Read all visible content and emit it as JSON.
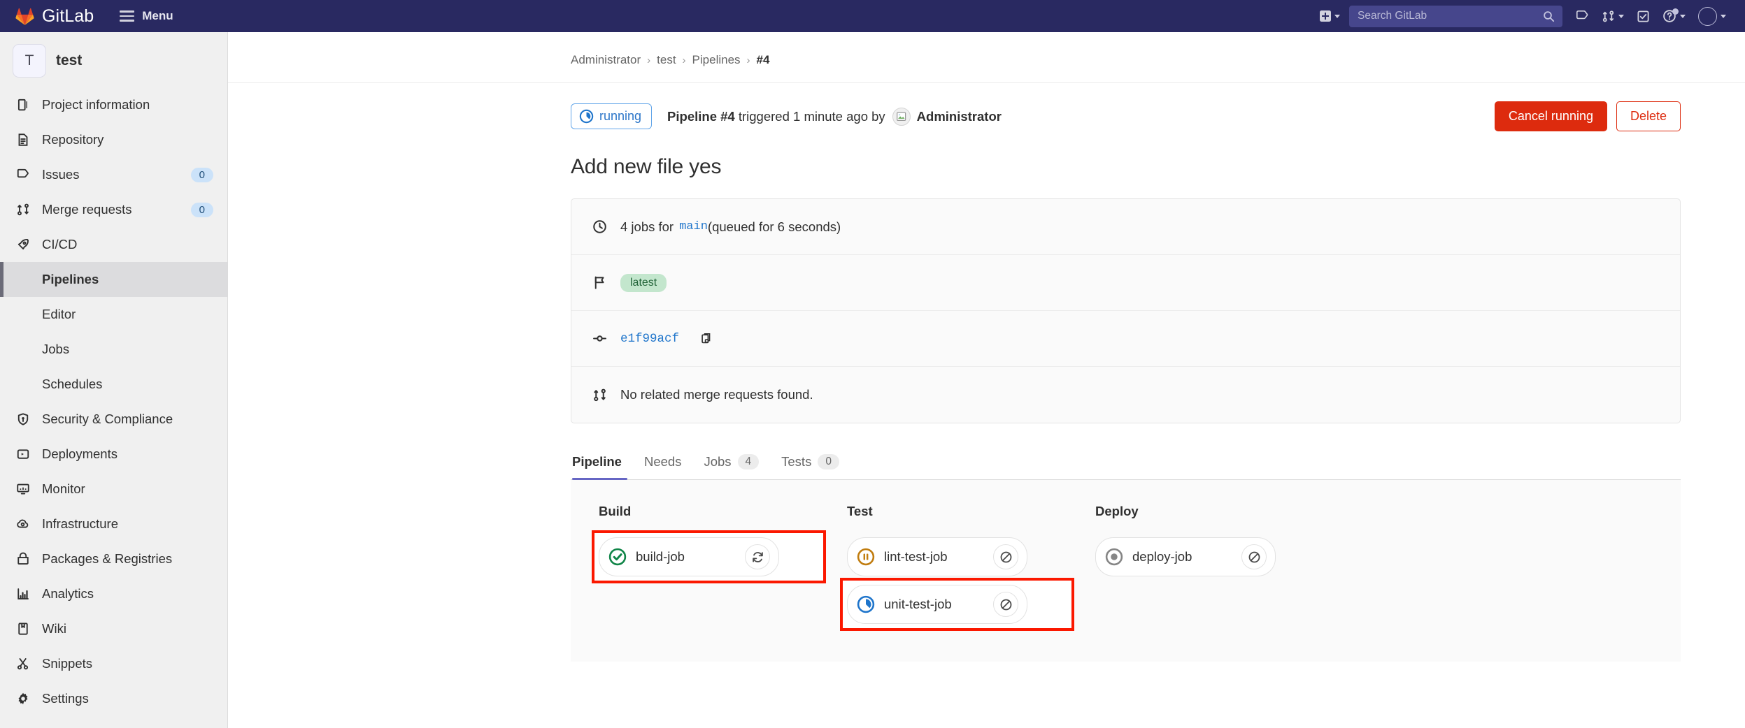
{
  "navbar": {
    "brand": "GitLab",
    "menu_label": "Menu",
    "create_new_label": "Create new",
    "search": {
      "placeholder": "Search GitLab",
      "value": ""
    },
    "icons": [
      {
        "name": "issues-icon",
        "label": "Issues"
      },
      {
        "name": "merge-requests-icon",
        "label": "Merge requests"
      },
      {
        "name": "todos-icon",
        "label": "To-Do List"
      },
      {
        "name": "help-icon",
        "label": "Help"
      },
      {
        "name": "user-avatar",
        "label": "User menu"
      }
    ]
  },
  "sidebar": {
    "project": {
      "initial": "T",
      "name": "test"
    },
    "items": [
      {
        "label": "Project information",
        "icon": "project-information-icon",
        "badge": ""
      },
      {
        "label": "Repository",
        "icon": "repository-icon",
        "badge": ""
      },
      {
        "label": "Issues",
        "icon": "issues-icon",
        "badge": "0"
      },
      {
        "label": "Merge requests",
        "icon": "merge-requests-icon",
        "badge": "0"
      },
      {
        "label": "CI/CD",
        "icon": "cicd-icon",
        "badge": ""
      }
    ],
    "cicd_subitems": [
      {
        "label": "Pipelines",
        "active": true
      },
      {
        "label": "Editor",
        "active": false
      },
      {
        "label": "Jobs",
        "active": false
      },
      {
        "label": "Schedules",
        "active": false
      }
    ],
    "items_after": [
      {
        "label": "Security & Compliance",
        "icon": "shield-icon",
        "badge": ""
      },
      {
        "label": "Deployments",
        "icon": "deployments-icon",
        "badge": ""
      },
      {
        "label": "Monitor",
        "icon": "monitor-icon",
        "badge": ""
      },
      {
        "label": "Infrastructure",
        "icon": "infrastructure-icon",
        "badge": ""
      },
      {
        "label": "Packages & Registries",
        "icon": "packages-icon",
        "badge": ""
      },
      {
        "label": "Analytics",
        "icon": "analytics-icon",
        "badge": ""
      },
      {
        "label": "Wiki",
        "icon": "wiki-icon",
        "badge": ""
      },
      {
        "label": "Snippets",
        "icon": "snippets-icon",
        "badge": ""
      },
      {
        "label": "Settings",
        "icon": "gear-icon",
        "badge": ""
      }
    ]
  },
  "breadcrumb": {
    "items": [
      "Administrator",
      "test",
      "Pipelines"
    ],
    "current": "#4",
    "separator": "›"
  },
  "pipeline": {
    "status": "running",
    "title_prefix": "Pipeline",
    "number": "#4",
    "triggered_text": "triggered 1 minute ago by",
    "author": "Administrator",
    "commit_title": "Add new file yes",
    "actions": {
      "cancel": "Cancel running",
      "delete": "Delete"
    },
    "info": {
      "jobs_count_text": "4 jobs for",
      "ref": "main",
      "queued_text": "(queued for 6 seconds)",
      "tag": "latest",
      "commit_sha": "e1f99acf",
      "merge_request_text": "No related merge requests found."
    },
    "tabs": [
      {
        "label": "Pipeline",
        "count": "",
        "active": true
      },
      {
        "label": "Needs",
        "count": "",
        "active": false
      },
      {
        "label": "Jobs",
        "count": "4",
        "active": false
      },
      {
        "label": "Tests",
        "count": "0",
        "active": false
      }
    ],
    "stages": [
      {
        "name": "Build",
        "jobs": [
          {
            "name": "build-job",
            "status": "success",
            "action": "retry-icon",
            "highlighted": true
          }
        ]
      },
      {
        "name": "Test",
        "jobs": [
          {
            "name": "lint-test-job",
            "status": "pending",
            "action": "cancel-icon",
            "highlighted": false
          },
          {
            "name": "unit-test-job",
            "status": "running",
            "action": "cancel-icon",
            "highlighted": true
          }
        ]
      },
      {
        "name": "Deploy",
        "jobs": [
          {
            "name": "deploy-job",
            "status": "created",
            "action": "cancel-icon",
            "highlighted": false
          }
        ]
      }
    ]
  },
  "colors": {
    "navbar_bg": "#292961",
    "accent": "#6666c4",
    "danger": "#dd2b0e",
    "link": "#1f75cb",
    "success": "#108548",
    "pending": "#c17d10",
    "running": "#1f75cb",
    "created": "#868686",
    "highlight": "#fb1800"
  }
}
